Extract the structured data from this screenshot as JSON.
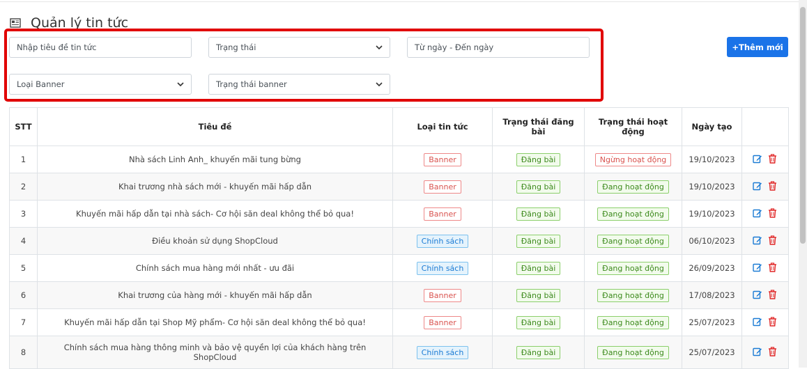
{
  "page": {
    "title": "Quản lý tin tức"
  },
  "filters": {
    "title_placeholder": "Nhập tiêu đề tin tức",
    "status_selected": "Trạng thái",
    "date_placeholder": "Từ ngày - Đến ngày",
    "banner_type_selected": "Loại Banner",
    "banner_status_selected": "Trạng thái banner"
  },
  "add_button": {
    "label": "+Thêm mới"
  },
  "table": {
    "headers": {
      "stt": "STT",
      "title": "Tiêu đề",
      "type": "Loại tin tức",
      "post_status": "Trạng thái đăng bài",
      "active_status": "Trạng thái hoạt động",
      "created": "Ngày tạo"
    },
    "rows": [
      {
        "stt": "1",
        "title": "Nhà sách Linh Anh_ khuyến mãi tung bừng",
        "type": "Banner",
        "post_status": "Đăng bài",
        "active_status": "Ngừng hoạt động",
        "created": "19/10/2023"
      },
      {
        "stt": "2",
        "title": "Khai trương nhà sách mới - khuyến mãi hấp dẫn",
        "type": "Banner",
        "post_status": "Đăng bài",
        "active_status": "Đang hoạt động",
        "created": "19/10/2023"
      },
      {
        "stt": "3",
        "title": "Khuyến mãi hấp dẫn tại nhà sách- Cơ hội săn deal không thể bỏ qua!",
        "type": "Banner",
        "post_status": "Đăng bài",
        "active_status": "Đang hoạt động",
        "created": "19/10/2023"
      },
      {
        "stt": "4",
        "title": "Điều khoản sử dụng ShopCloud",
        "type": "Chính sách",
        "post_status": "Đăng bài",
        "active_status": "Đang hoạt động",
        "created": "06/10/2023"
      },
      {
        "stt": "5",
        "title": "Chính sách mua hàng mới nhất - ưu đãi",
        "type": "Chính sách",
        "post_status": "Đăng bài",
        "active_status": "Đang hoạt động",
        "created": "26/09/2023"
      },
      {
        "stt": "6",
        "title": "Khai trương của hàng mới - khuyến mãi hấp dẫn",
        "type": "Banner",
        "post_status": "Đăng bài",
        "active_status": "Đang hoạt động",
        "created": "17/08/2023"
      },
      {
        "stt": "7",
        "title": "Khuyến mãi hấp dẫn tại Shop Mỹ phẩm- Cơ hội săn deal không thể bỏ qua!",
        "type": "Banner",
        "post_status": "Đăng bài",
        "active_status": "Đang hoạt động",
        "created": "25/07/2023"
      },
      {
        "stt": "8",
        "title": "Chính sách mua hàng thông minh và bảo vệ quyền lợi của khách hàng trên ShopCloud",
        "type": "Chính sách",
        "post_status": "Đăng bài",
        "active_status": "Đang hoạt động",
        "created": "25/07/2023"
      }
    ]
  },
  "colors": {
    "accent": "#1a73e8",
    "highlight_border": "#e10000",
    "danger": "#d9534f",
    "success": "#3c8a1c",
    "info": "#1b7bd4"
  },
  "icons": {
    "page": "newspaper-icon",
    "edit": "edit-icon",
    "delete": "trash-icon",
    "select": "chevron-down-icon"
  }
}
